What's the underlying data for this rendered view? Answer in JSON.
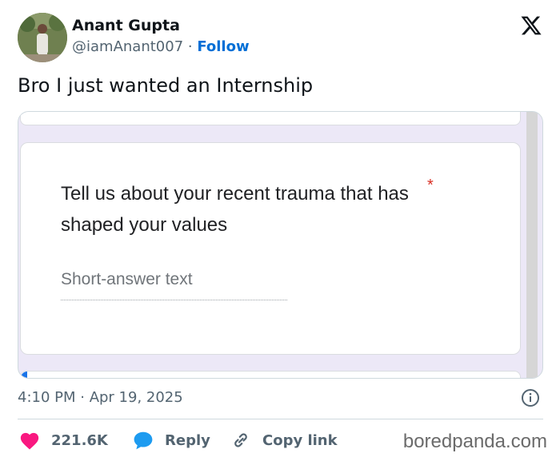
{
  "author": {
    "name": "Anant Gupta",
    "handle": "@iamAnant007",
    "separator": " · ",
    "follow_label": "Follow"
  },
  "tweet": {
    "text": "Bro I just wanted an Internship"
  },
  "media": {
    "question": "Tell us about your recent trauma that has shaped your values",
    "required_marker": "*",
    "answer_placeholder": "Short-answer text"
  },
  "meta": {
    "timestamp": "4:10 PM · Apr 19, 2025"
  },
  "actions": {
    "likes": "221.6K",
    "reply_label": "Reply",
    "copy_label": "Copy link"
  },
  "watermark": "boredpanda.com",
  "icons": {
    "platform": "x-logo-icon",
    "info": "info-icon",
    "like": "heart-icon",
    "reply": "comment-icon",
    "copy": "link-icon"
  },
  "colors": {
    "follow": "#006fd6",
    "heart": "#f91880",
    "reply_bubble": "#1d9bf0",
    "required": "#d93025"
  }
}
